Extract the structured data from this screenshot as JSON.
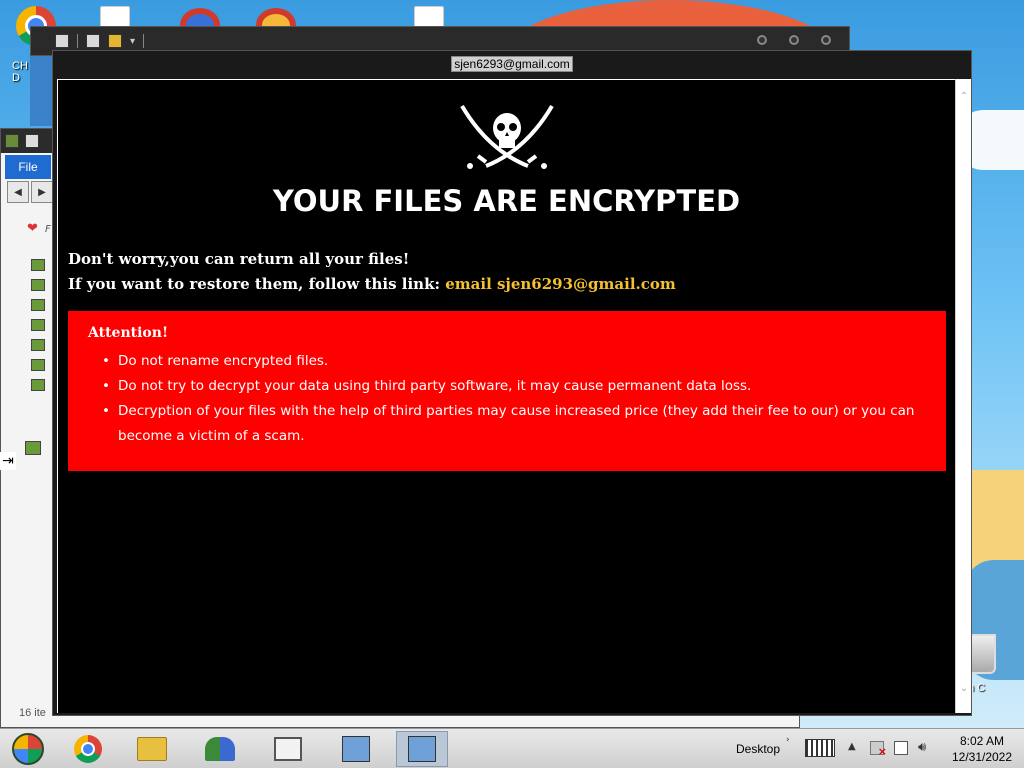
{
  "desktop": {
    "chrome_label": "CH\nD",
    "recycle_label": "n C"
  },
  "explorer": {
    "menu_file": "File",
    "fav_label": "F",
    "status_count": "16 ite"
  },
  "note": {
    "title_email": "sjen6293@gmail.com",
    "headline": "YOUR FILES ARE ENCRYPTED",
    "line1": "Don't worry,you can return all your files!",
    "line2_prefix": "If you want to restore them, follow this link: ",
    "line2_link": "email sjen6293@gmail.com",
    "attention_title": "Attention!",
    "attention_items": [
      "Do not rename encrypted files.",
      "Do not try to decrypt your data using third party software, it may cause permanent data loss.",
      "Decryption of your files with the help of third parties may cause increased price (they add their fee to our) or you can become a victim of a scam."
    ],
    "colors": {
      "background": "#000000",
      "alert_box": "#ff0000",
      "link": "#f5c02e",
      "text": "#ffffff"
    }
  },
  "taskbar": {
    "desktop_label": "Desktop",
    "time": "8:02 AM",
    "date": "12/31/2022",
    "icons": [
      "start-orb-icon",
      "chrome-icon",
      "folder-icon",
      "people-icon",
      "box-icon",
      "installer-icon",
      "installer-icon"
    ]
  }
}
